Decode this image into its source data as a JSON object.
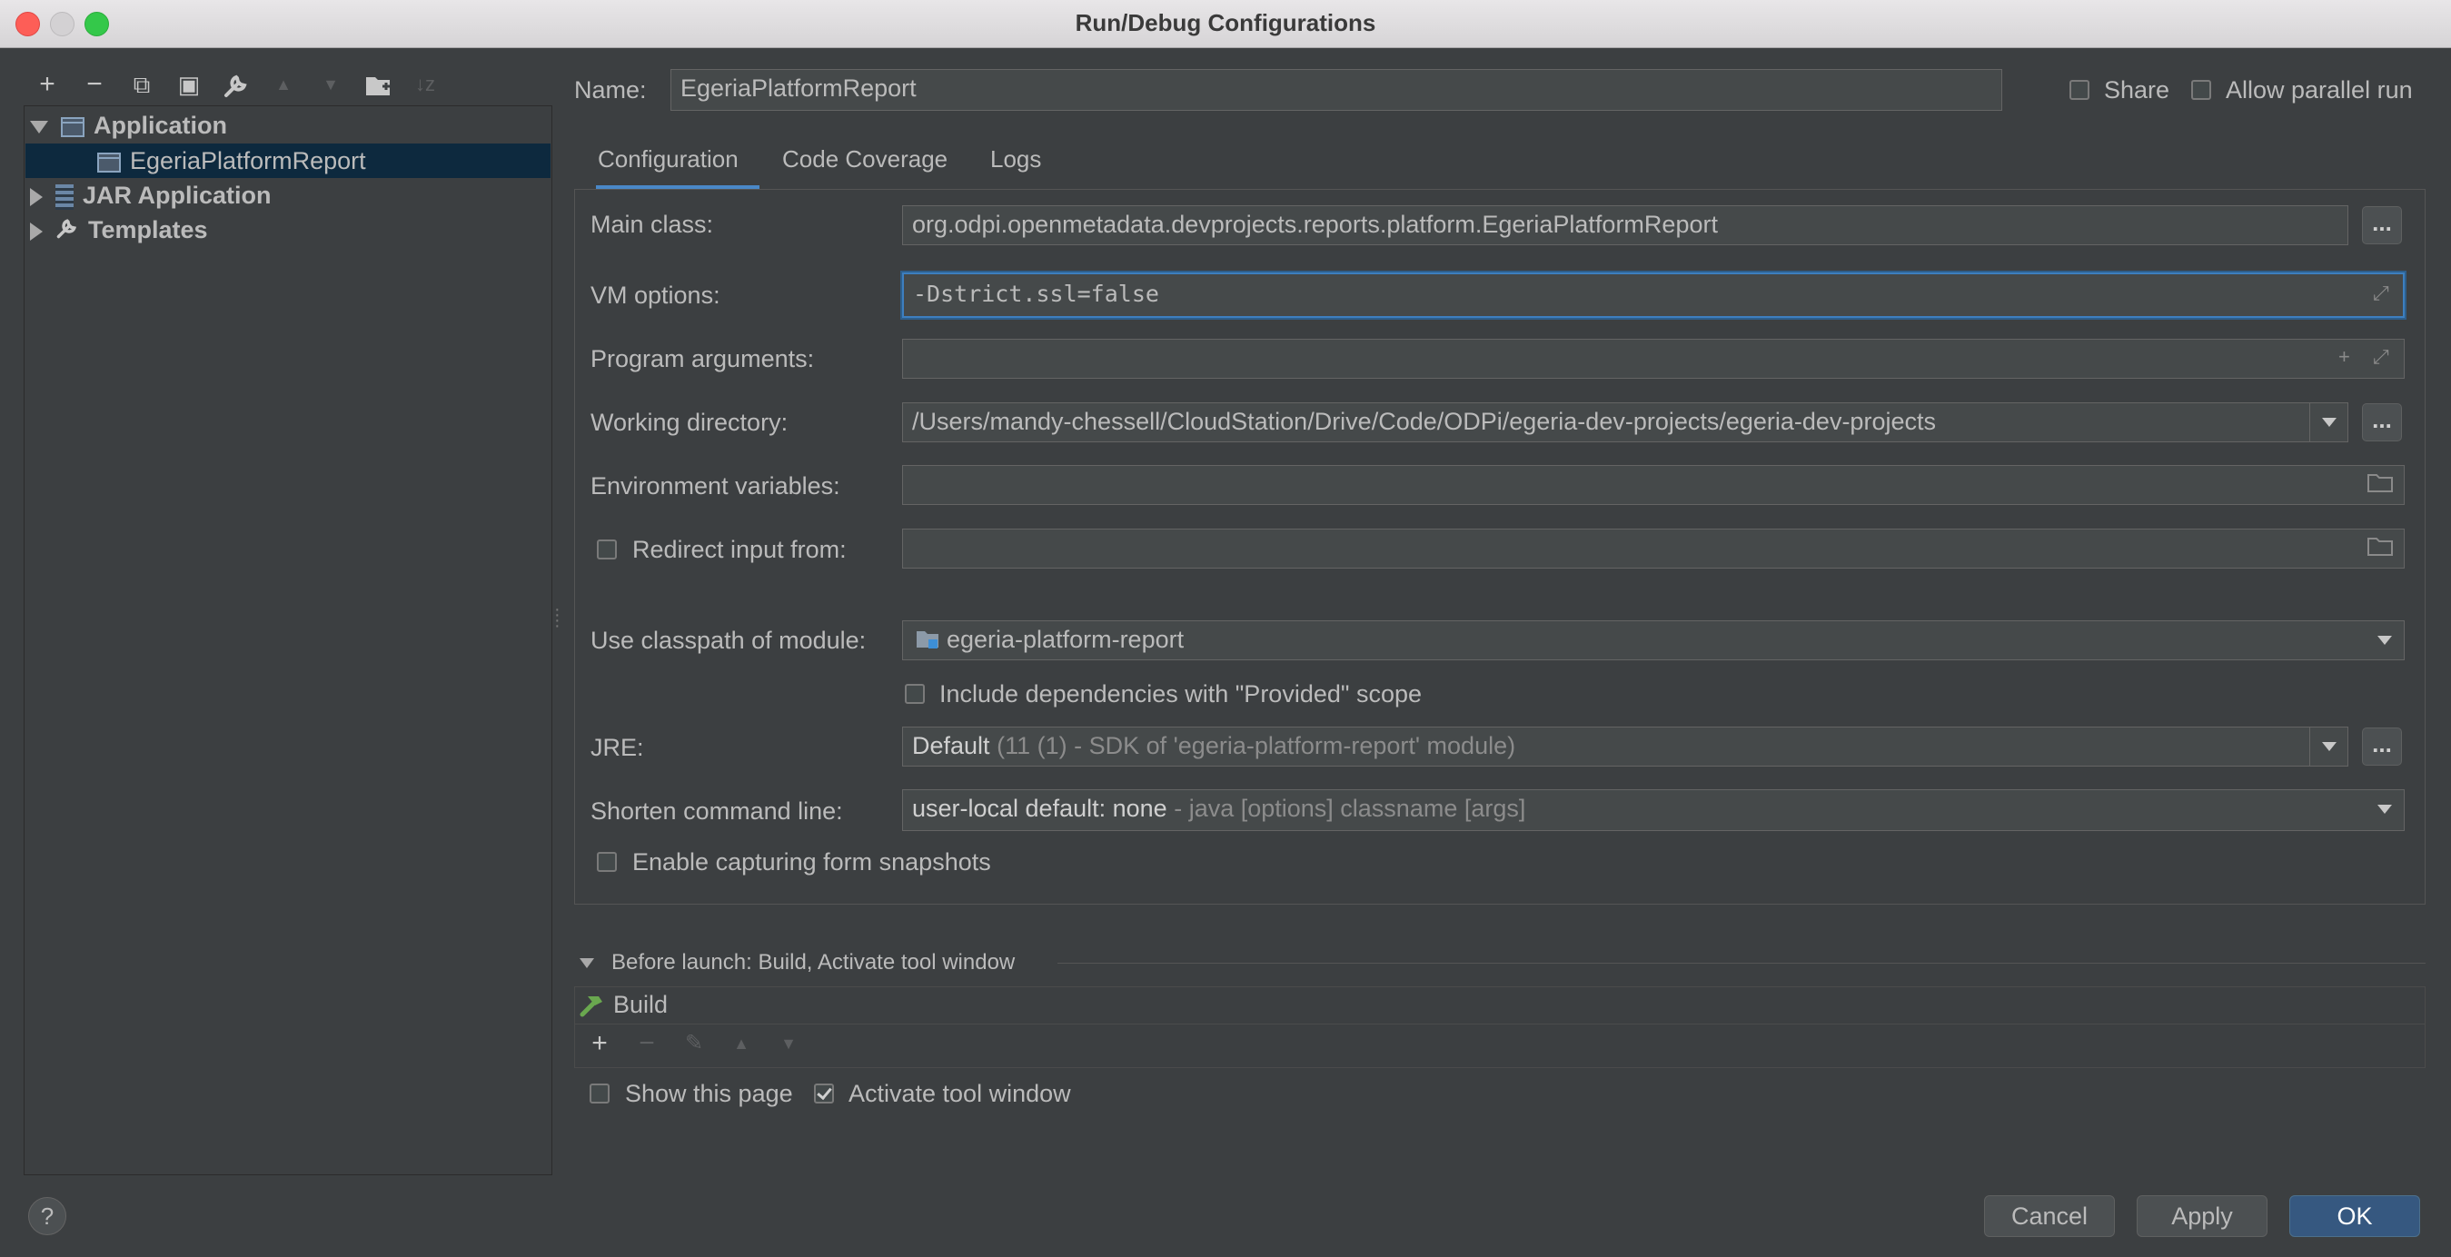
{
  "window": {
    "title": "Run/Debug Configurations"
  },
  "left_toolbar": {
    "icons": [
      "add-icon",
      "remove-icon",
      "copy-icon",
      "save-icon",
      "wrench-icon",
      "move-up-icon",
      "move-down-icon",
      "folder-icon",
      "sort-icon"
    ],
    "glyphs": [
      "+",
      "−",
      "⧉",
      "▣",
      "🔧",
      "▲",
      "▼",
      "📁",
      "↓z"
    ]
  },
  "tree": {
    "items": [
      {
        "label": "Application",
        "expanded": true
      },
      {
        "label": "EgeriaPlatformReport",
        "selected": true
      },
      {
        "label": "JAR Application",
        "expanded": false
      },
      {
        "label": "Templates",
        "expanded": false
      }
    ]
  },
  "header": {
    "name_label": "Name:",
    "name_value": "EgeriaPlatformReport",
    "share_label": "Share",
    "share_checked": false,
    "parallel_label": "Allow parallel run",
    "parallel_checked": false
  },
  "tabs": [
    {
      "label": "Configuration",
      "active": true
    },
    {
      "label": "Code Coverage",
      "active": false
    },
    {
      "label": "Logs",
      "active": false
    }
  ],
  "config": {
    "main_class_label": "Main class:",
    "main_class_value": "org.odpi.openmetadata.devprojects.reports.platform.EgeriaPlatformReport",
    "vm_options_label": "VM options:",
    "vm_options_value": "-Dstrict.ssl=false",
    "program_args_label": "Program arguments:",
    "program_args_value": "",
    "working_dir_label": "Working directory:",
    "working_dir_value": "/Users/mandy-chessell/CloudStation/Drive/Code/ODPi/egeria-dev-projects/egeria-dev-projects",
    "env_vars_label": "Environment variables:",
    "env_vars_value": "",
    "redirect_label": "Redirect input from:",
    "redirect_checked": false,
    "redirect_value": "",
    "classpath_label": "Use classpath of module:",
    "classpath_value": "egeria-platform-report",
    "include_deps_label": "Include dependencies with \"Provided\" scope",
    "include_deps_checked": false,
    "jre_label": "JRE:",
    "jre_value": "Default",
    "jre_detail": "(11 (1) - SDK of 'egeria-platform-report' module)",
    "shorten_label": "Shorten command line:",
    "shorten_value": "user-local default: none",
    "shorten_detail": "- java [options] classname [args]",
    "snapshots_label": "Enable capturing form snapshots",
    "snapshots_checked": false,
    "ellipsis": "..."
  },
  "before_launch": {
    "title": "Before launch: Build, Activate tool window",
    "items": [
      "Build"
    ],
    "show_page_label": "Show this page",
    "show_page_checked": false,
    "activate_label": "Activate tool window",
    "activate_checked": true
  },
  "footer": {
    "help": "?",
    "cancel": "Cancel",
    "apply": "Apply",
    "ok": "OK"
  },
  "colors": {
    "background": "#3c3f41",
    "selection": "#0d293e",
    "accent": "#4a88c7",
    "primary_button": "#365880"
  }
}
